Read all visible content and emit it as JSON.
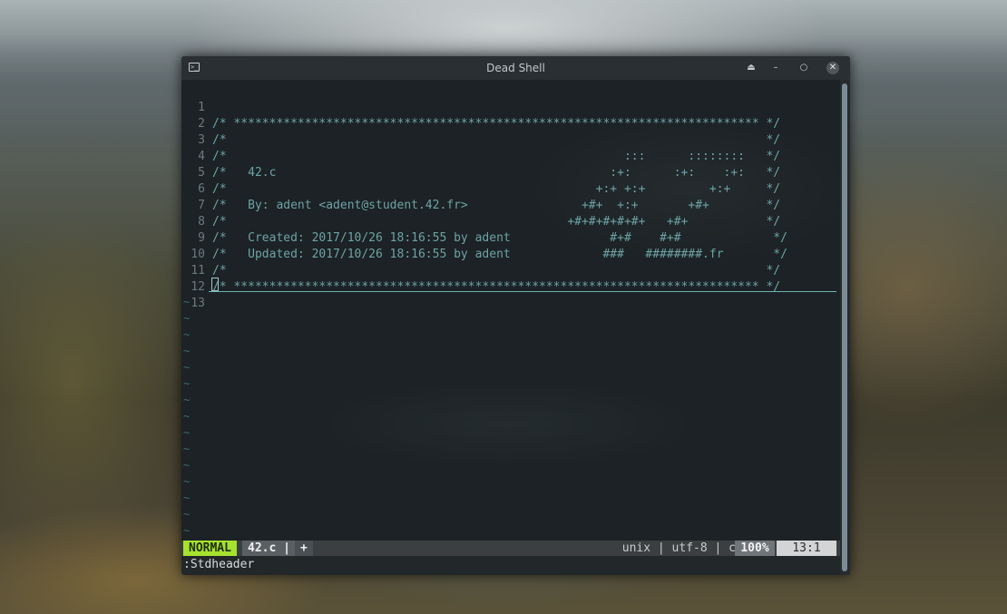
{
  "window": {
    "title": "Dead Shell",
    "icon": "terminal-icon",
    "buttons": [
      "eject-icon",
      "minimize-icon",
      "restore-icon",
      "close-icon"
    ]
  },
  "editor": {
    "lines": [
      {
        "num": "1",
        "text": "/* ************************************************************************** */"
      },
      {
        "num": "2",
        "text": "/*                                                                            */"
      },
      {
        "num": "3",
        "text": "/*                                                        :::      ::::::::   */"
      },
      {
        "num": "4",
        "text": "/*   42.c                                               :+:      :+:    :+:   */"
      },
      {
        "num": "5",
        "text": "/*                                                    +:+ +:+         +:+     */"
      },
      {
        "num": "6",
        "text": "/*   By: adent <adent@student.42.fr>                +#+  +:+       +#+        */"
      },
      {
        "num": "7",
        "text": "/*                                                +#+#+#+#+#+   +#+           */"
      },
      {
        "num": "8",
        "text": "/*   Created: 2017/10/26 18:16:55 by adent              #+#    #+#             */"
      },
      {
        "num": "9",
        "text": "/*   Updated: 2017/10/26 18:16:55 by adent             ###   ########.fr       */"
      },
      {
        "num": "10",
        "text": "/*                                                                            */"
      },
      {
        "num": "11",
        "text": "/* ************************************************************************** */"
      },
      {
        "num": "12",
        "text": ""
      },
      {
        "num": "13",
        "text": ""
      }
    ],
    "empty_marker": "~"
  },
  "statusline": {
    "mode": "NORMAL",
    "file": "42.c |",
    "modified": "+",
    "info": "unix | utf-8 | c",
    "percent": "100%",
    "position": "13:1"
  },
  "cmdline": ":Stdheader",
  "colors": {
    "mode_bg": "#a6e22e",
    "code_fg": "#6ea3a6",
    "line_number_fg": "#6d7b7e"
  }
}
